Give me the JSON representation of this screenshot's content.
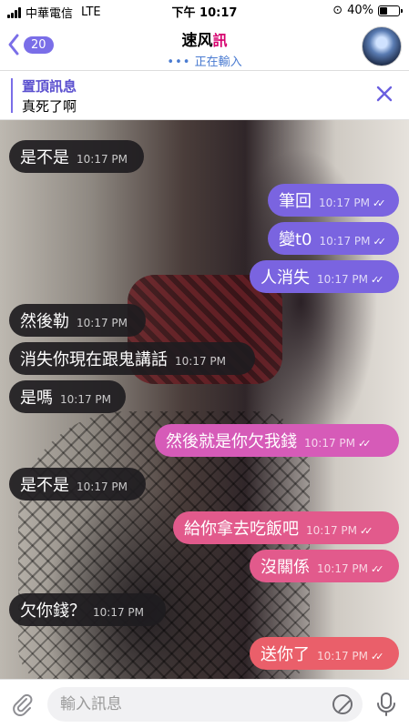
{
  "status": {
    "carrier": "中華電信",
    "network": "LTE",
    "time": "下午 10:17",
    "battery": "40%",
    "battery_level": 0.4
  },
  "header": {
    "back_count": "20",
    "title": "速风",
    "title_deco": "訊",
    "status": "正在輸入"
  },
  "pinned": {
    "label": "置頂訊息",
    "text": "真死了啊"
  },
  "messages": [
    {
      "text": "是不是",
      "time": "10:17 PM"
    },
    {
      "text": "筆回",
      "time": "10:17 PM"
    },
    {
      "text": "變t0",
      "time": "10:17 PM"
    },
    {
      "text": "人消失",
      "time": "10:17 PM"
    },
    {
      "text": "然後勒",
      "time": "10:17 PM"
    },
    {
      "text": "消失你現在跟鬼講話",
      "time": "10:17 PM"
    },
    {
      "text": "是嗎",
      "time": "10:17 PM"
    },
    {
      "text": "然後就是你欠我錢",
      "time": "10:17 PM"
    },
    {
      "text": "是不是",
      "time": "10:17 PM"
    },
    {
      "text": "給你拿去吃飯吧",
      "time": "10:17 PM"
    },
    {
      "text": "沒關係",
      "time": "10:17 PM"
    },
    {
      "text": "欠你錢？",
      "time": "10:17 PM"
    },
    {
      "text": "送你了",
      "time": "10:17 PM"
    }
  ],
  "input": {
    "placeholder": "輸入訊息"
  },
  "colors": {
    "accent": "#7a6ee8",
    "outgoing_purple": "#7a64e0",
    "outgoing_pink": "#d65bb8",
    "outgoing_rose": "#e25a8c",
    "outgoing_coral": "#ea5f6a"
  },
  "icons": {
    "back": "chevron-left-icon",
    "close": "close-icon",
    "attach": "paperclip-icon",
    "sticker": "sticker-icon",
    "mic": "microphone-icon"
  }
}
